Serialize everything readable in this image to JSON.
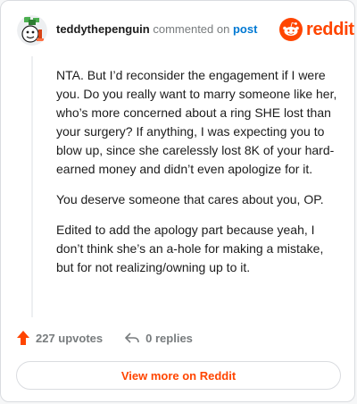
{
  "comment": {
    "username": "teddythepenguin",
    "action_text": "commented on",
    "post_link_text": "post",
    "body_paragraphs": [
      "NTA. But I’d reconsider the engagement if I were you. Do you really want to marry someone like her, who’s more concerned about a ring SHE lost than your surgery? If anything, I was expecting you to blow up, since she carelessly lost 8K of your hard-earned money and didn’t even apologize for it.",
      "You deserve someone that cares about you, OP.",
      "Edited to add the apology part because yeah, I don’t think she’s an a-hole for making a mistake, but for not realizing/owning up to it."
    ]
  },
  "brand": {
    "logo_icon": "reddit-snoo-icon",
    "wordmark": "reddit",
    "color": "#ff4500"
  },
  "actions": {
    "upvotes_label": "227 upvotes",
    "replies_label": "0 replies",
    "upvote_icon": "upvote-arrow-icon",
    "reply_icon": "reply-arrow-icon",
    "upvote_color": "#ff4500"
  },
  "footer": {
    "view_more_label": "View more on Reddit"
  },
  "colors": {
    "link_blue": "#0079d3",
    "text_dark": "#1c1c1c",
    "text_muted": "#787c7e"
  }
}
